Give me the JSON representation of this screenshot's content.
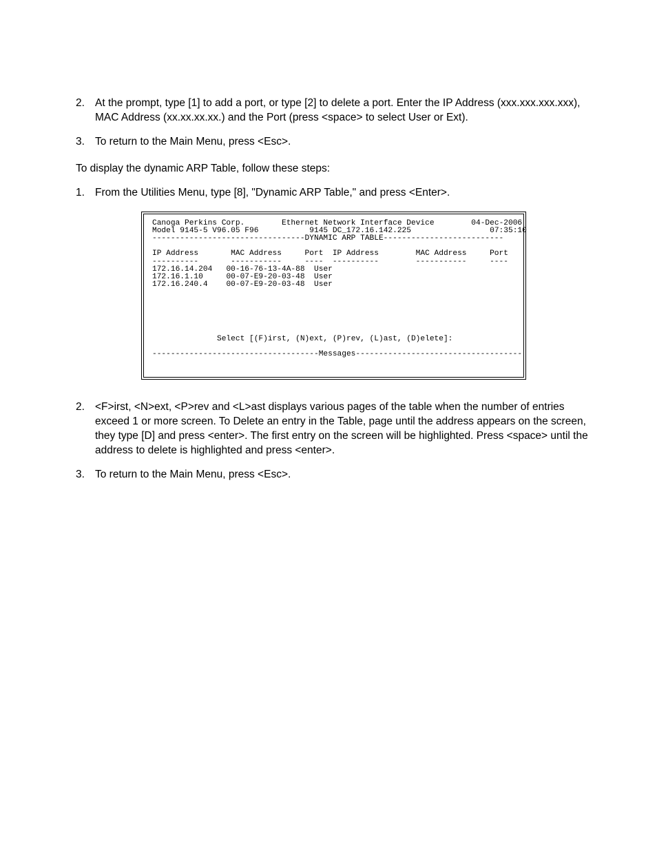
{
  "section_a": {
    "items": [
      {
        "num": "2.",
        "text": "At the prompt, type [1] to add a port, or type [2] to delete a port.  Enter the IP Address (xxx.xxx.xxx.xxx), MAC Address (xx.xx.xx.xx.) and the Port (press <space> to select User or Ext)."
      },
      {
        "num": "3.",
        "text": "To return to the Main Menu, press <Esc>."
      }
    ]
  },
  "intro_para": "To display the dynamic ARP Table, follow these steps:",
  "section_b": {
    "items": [
      {
        "num": "1.",
        "text": "From the Utilities Menu, type [8], \"Dynamic ARP Table,\" and press <Enter>."
      }
    ]
  },
  "terminal": {
    "header": {
      "company": "Canoga Perkins Corp.",
      "device": "Ethernet Network Interface Device",
      "date": "04-Dec-2006",
      "model": "Model 9145-5 V96.05 F96",
      "host": "9145 DC_172.16.142.225",
      "time": "07:35:10",
      "title_sep": "---------------------------------DYNAMIC ARP TABLE--------------------------"
    },
    "columns": {
      "line1": "IP Address       MAC Address     Port  IP Address        MAC Address     Port",
      "line2": "----------       -----------     ----  ----------        -----------     ----"
    },
    "rows": [
      {
        "ip": "172.16.14.204",
        "mac": "00-16-76-13-4A-88",
        "port": "User"
      },
      {
        "ip": "172.16.1.10",
        "mac": "00-07-E9-20-03-48",
        "port": "User"
      },
      {
        "ip": "172.16.240.4",
        "mac": "00-07-E9-20-03-48",
        "port": "User"
      }
    ],
    "select_line": "Select [(F)irst, (N)ext, (P)rev, (L)ast, (D)elete]:",
    "messages_sep": "------------------------------------Messages------------------------------------"
  },
  "section_c": {
    "items": [
      {
        "num": "2.",
        "text": "<F>irst, <N>ext, <P>rev and <L>ast displays various pages of the table when the number of entries exceed 1 or more screen.  To Delete an entry in the Table, page until the address appears on the screen, they type [D] and press <enter>.  The first entry on the screen will be highlighted.  Press <space> until the address to delete is highlighted and press <enter>."
      },
      {
        "num": "3.",
        "text": "To return to the Main Menu, press <Esc>."
      }
    ]
  }
}
